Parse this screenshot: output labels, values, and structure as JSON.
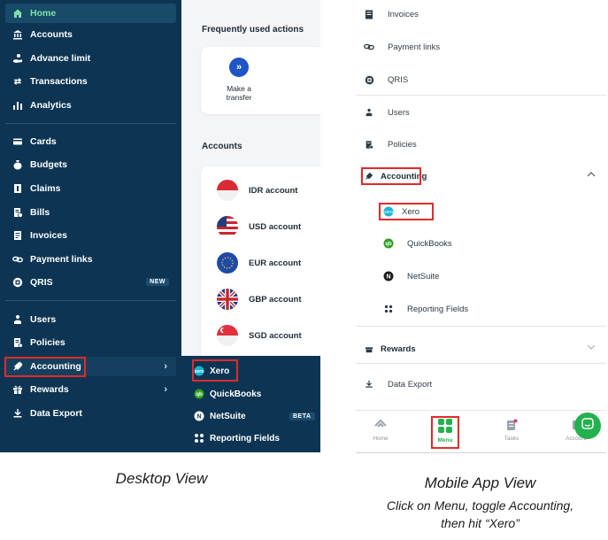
{
  "desktop": {
    "nav": {
      "home": "Home",
      "accounts": "Accounts",
      "advance_limit": "Advance limit",
      "transactions": "Transactions",
      "analytics": "Analytics",
      "cards": "Cards",
      "budgets": "Budgets",
      "claims": "Claims",
      "bills": "Bills",
      "invoices": "Invoices",
      "payment_links": "Payment links",
      "qris": "QRIS",
      "qris_badge": "NEW",
      "users": "Users",
      "policies": "Policies",
      "accounting": "Accounting",
      "rewards": "Rewards",
      "data_export": "Data Export"
    },
    "main": {
      "frequent_title": "Frequently used actions",
      "action_label": "Make a transfer",
      "accounts_title": "Accounts",
      "accounts": [
        "IDR account",
        "USD account",
        "EUR account",
        "GBP account",
        "SGD account"
      ]
    },
    "submenu": {
      "xero": "Xero",
      "quickbooks": "QuickBooks",
      "netsuite": "NetSuite",
      "netsuite_badge": "BETA",
      "reporting_fields": "Reporting Fields"
    }
  },
  "mobile": {
    "items": {
      "invoices": "Invoices",
      "payment_links": "Payment links",
      "qris": "QRIS",
      "users": "Users",
      "policies": "Policies",
      "accounting": "Accounting",
      "xero": "Xero",
      "quickbooks": "QuickBooks",
      "netsuite": "NetSuite",
      "reporting_fields": "Reporting Fields",
      "rewards": "Rewards",
      "data_export": "Data Export"
    },
    "tabs": {
      "home": "Home",
      "menu": "Menu",
      "tasks": "Tasks",
      "account": "Account"
    }
  },
  "captions": {
    "desktop": "Desktop View",
    "mobile": "Mobile App View",
    "mobile_sub_line1": "Click on Menu, toggle Accounting,",
    "mobile_sub_line2": "then hit “Xero”"
  },
  "colors": {
    "sidebar_bg": "#0d3553",
    "active_green": "#7ee2a8",
    "highlight_red": "#e22a2a",
    "menu_green": "#23b14d"
  }
}
